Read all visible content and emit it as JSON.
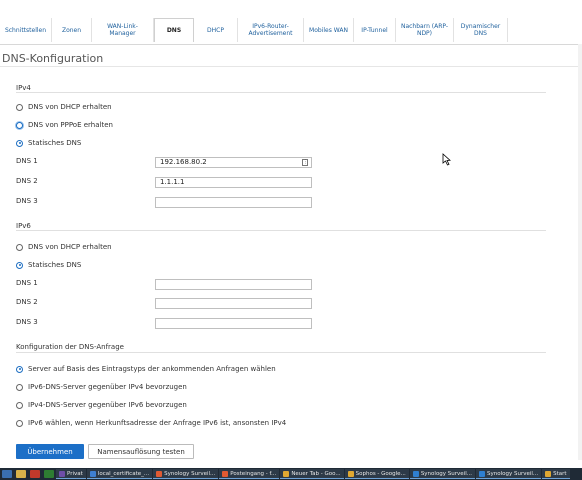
{
  "tabs": [
    {
      "label": "Schnittstellen",
      "name": "tab-schnittstellen"
    },
    {
      "label": "Zonen",
      "name": "tab-zonen"
    },
    {
      "label": "WAN-Link-Manager",
      "name": "tab-wan-link-manager"
    },
    {
      "label": "DNS",
      "name": "tab-dns"
    },
    {
      "label": "DHCP",
      "name": "tab-dhcp"
    },
    {
      "label": "IPv6-Router-Advertisement",
      "name": "tab-ipv6-router-advertisement"
    },
    {
      "label": "Mobiles WAN",
      "name": "tab-mobiles-wan"
    },
    {
      "label": "IP-Tunnel",
      "name": "tab-ip-tunnel"
    },
    {
      "label": "Nachbarn (ARP-NDP)",
      "name": "tab-nachbarn"
    },
    {
      "label": "Dynamischer DNS",
      "name": "tab-dynamischer-dns"
    }
  ],
  "active_tab": "DNS",
  "page_title": "DNS-Konfiguration",
  "ipv4": {
    "title": "IPv4",
    "options": [
      "DNS von DHCP erhalten",
      "DNS von PPPoE erhalten",
      "Statisches DNS"
    ],
    "selected": "Statisches DNS",
    "fields": [
      {
        "label": "DNS 1",
        "value": "192.168.80.2"
      },
      {
        "label": "DNS 2",
        "value": "1.1.1.1"
      },
      {
        "label": "DNS 3",
        "value": ""
      }
    ]
  },
  "ipv6": {
    "title": "IPv6",
    "options": [
      "DNS von DHCP erhalten",
      "Statisches DNS"
    ],
    "selected": "Statisches DNS",
    "fields": [
      {
        "label": "DNS 1",
        "value": ""
      },
      {
        "label": "DNS 2",
        "value": ""
      },
      {
        "label": "DNS 3",
        "value": ""
      }
    ]
  },
  "query": {
    "title": "Konfiguration der DNS-Anfrage",
    "options": [
      "Server auf Basis des Eintragstyps der ankommenden Anfragen wählen",
      "IPv6-DNS-Server gegenüber IPv4 bevorzugen",
      "IPv4-DNS-Server gegenüber IPv6 bevorzugen",
      "IPv6 wählen, wenn Herkunftsadresse der Anfrage IPv6 ist, ansonsten IPv4"
    ],
    "selected": "Server auf Basis des Eintragstyps der ankommenden Anfragen wählen"
  },
  "buttons": {
    "apply": "Übernehmen",
    "test": "Namensauflösung testen"
  },
  "taskbar": {
    "items": [
      {
        "label": "Privat",
        "color": "#6e4ea8"
      },
      {
        "label": "local_certificate_...",
        "color": "#3f7fd0"
      },
      {
        "label": "Synology Surveil...",
        "color": "#e05a32"
      },
      {
        "label": "Posteingang - f...",
        "color": "#e05a32"
      },
      {
        "label": "Neuer Tab - Goo...",
        "color": "#e0a832"
      },
      {
        "label": "Sophos - Google...",
        "color": "#e0a832"
      },
      {
        "label": "Synology Surveil...",
        "color": "#2f7fd0"
      },
      {
        "label": "Synology Surveil...",
        "color": "#2f7fd0"
      },
      {
        "label": "Start",
        "color": "#e0a832"
      }
    ]
  },
  "colors": {
    "accent": "#1c6fc7",
    "link": "#1d5f9c",
    "taskbar": "#1f2a36"
  }
}
